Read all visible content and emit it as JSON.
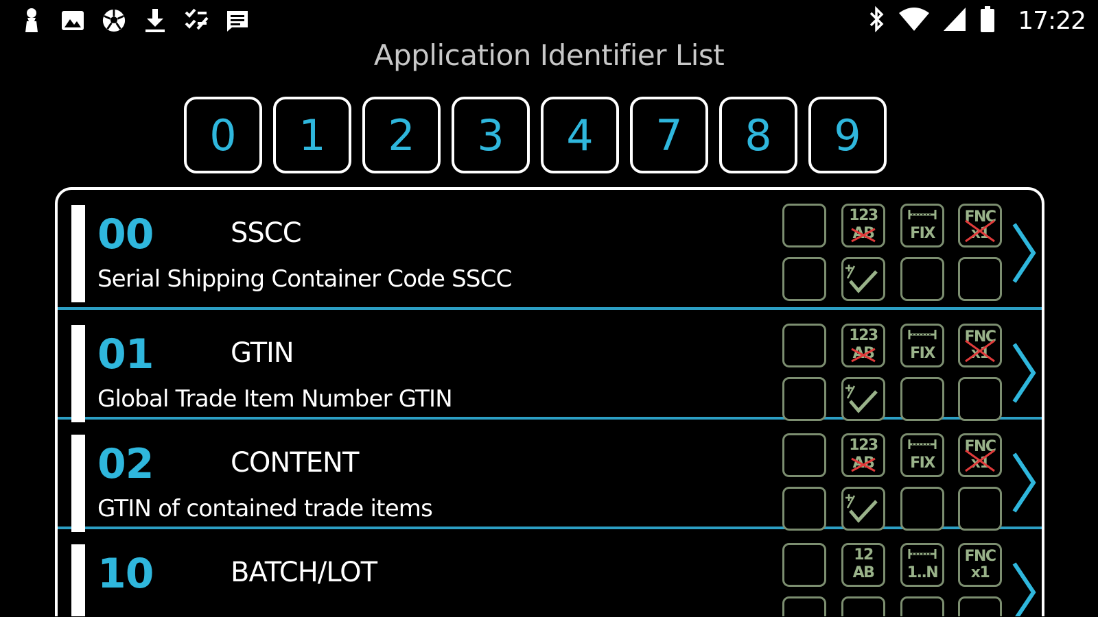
{
  "status_bar": {
    "left_icons": [
      "chess-pawn-icon",
      "image-icon",
      "soccer-ball-icon",
      "download-icon",
      "checklist-icon",
      "message-icon"
    ],
    "right_icons": [
      "bluetooth-icon",
      "wifi-icon",
      "signal-icon",
      "battery-icon"
    ],
    "time": "17:22"
  },
  "title": "Application Identifier List",
  "digit_filters": [
    "0",
    "1",
    "2",
    "3",
    "4",
    "7",
    "8",
    "9"
  ],
  "accent_color": "#2fb7dd",
  "ai_items": [
    {
      "code": "00",
      "name": "SSCC",
      "description": "Serial Shipping Container Code SSCC",
      "indicators": {
        "format_top": "123",
        "format_bottom": "AB",
        "format_crossed": true,
        "length_label": "FIX",
        "fnc_top": "FNC",
        "fnc_bottom": "x1",
        "fnc_crossed": true,
        "checksum": true
      }
    },
    {
      "code": "01",
      "name": "GTIN",
      "description": "Global Trade Item Number GTIN",
      "indicators": {
        "format_top": "123",
        "format_bottom": "AB",
        "format_crossed": true,
        "length_label": "FIX",
        "fnc_top": "FNC",
        "fnc_bottom": "x1",
        "fnc_crossed": true,
        "checksum": true
      }
    },
    {
      "code": "02",
      "name": "CONTENT",
      "description": "GTIN of contained trade items",
      "indicators": {
        "format_top": "123",
        "format_bottom": "AB",
        "format_crossed": true,
        "length_label": "FIX",
        "fnc_top": "FNC",
        "fnc_bottom": "x1",
        "fnc_crossed": true,
        "checksum": true
      }
    },
    {
      "code": "10",
      "name": "BATCH/LOT",
      "description": "",
      "indicators": {
        "format_top": "12",
        "format_bottom": "AB",
        "format_crossed": false,
        "length_label": "1..N",
        "fnc_top": "FNC",
        "fnc_bottom": "x1",
        "fnc_crossed": false,
        "checksum": false
      }
    }
  ]
}
